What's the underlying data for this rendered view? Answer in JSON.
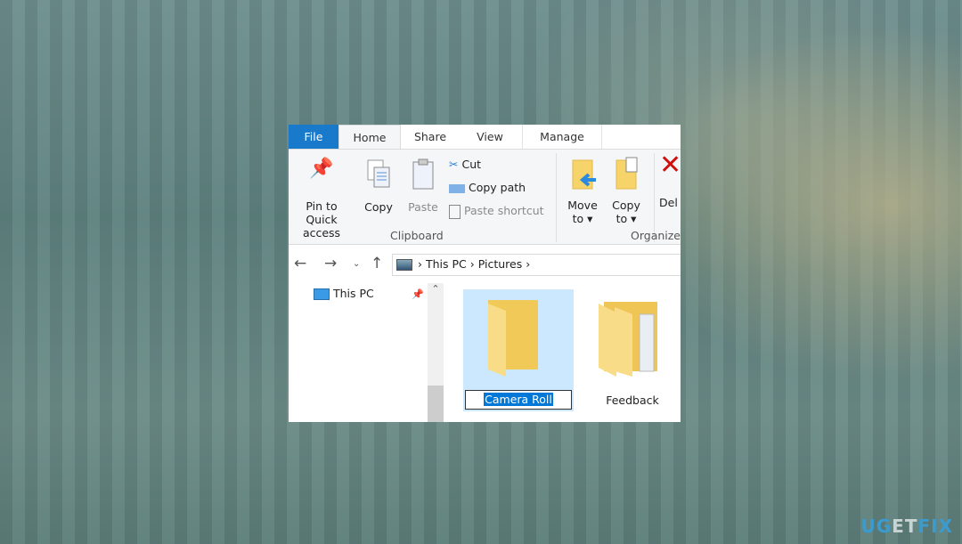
{
  "tabs": [
    {
      "label": "File"
    },
    {
      "label": "Home"
    },
    {
      "label": "Share"
    },
    {
      "label": "View"
    },
    {
      "label": "Manage"
    }
  ],
  "ribbon": {
    "pin": "Pin to Quick",
    "pin2": "access",
    "copy": "Copy",
    "paste": "Paste",
    "cut": "Cut",
    "copy_path": "Copy path",
    "paste_shortcut": "Paste shortcut",
    "clipboard": "Clipboard",
    "move": "Move",
    "move2": "to ▾",
    "copyto": "Copy",
    "copyto2": "to ▾",
    "delete": "Del",
    "organize": "Organize"
  },
  "address": {
    "crumbs": [
      "This PC",
      "Pictures"
    ]
  },
  "nav": {
    "this_pc": "This PC"
  },
  "folders": [
    {
      "name": "Camera Roll",
      "renaming": true
    },
    {
      "name": "Feedback"
    }
  ],
  "watermark": "UGETFIX",
  "colors": {
    "file_tab": "#1979ca",
    "selection": "#cce8ff",
    "rename_highlight": "#0078d7"
  }
}
